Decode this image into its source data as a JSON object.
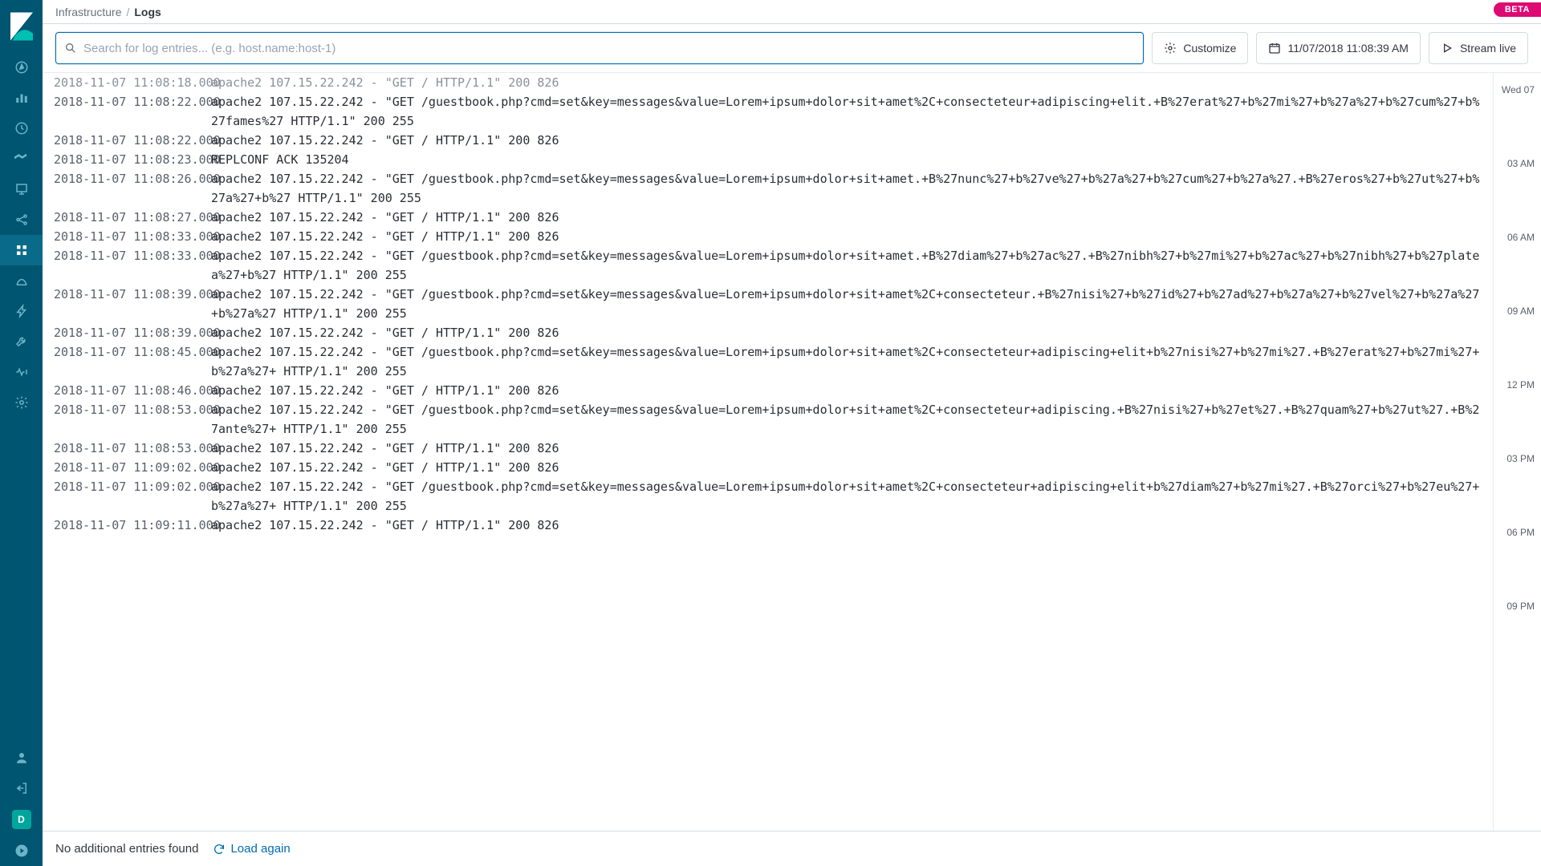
{
  "breadcrumb": {
    "parent": "Infrastructure",
    "current": "Logs"
  },
  "beta_label": "BETA",
  "search": {
    "placeholder": "Search for log entries... (e.g. host.name:host-1)"
  },
  "toolbar": {
    "customize": "Customize",
    "datetime": "11/07/2018 11:08:39 AM",
    "stream": "Stream live"
  },
  "minimap": {
    "day": "Wed 07",
    "ticks": [
      "03 AM",
      "06 AM",
      "09 AM",
      "12 PM",
      "03 PM",
      "06 PM",
      "09 PM"
    ]
  },
  "footer": {
    "status": "No additional entries found",
    "load_again": "Load again"
  },
  "user_badge": "D",
  "logs": [
    {
      "ts": "2018-11-07 11:08:18.000",
      "msg": "apache2 107.15.22.242 - \"GET / HTTP/1.1\" 200 826"
    },
    {
      "ts": "2018-11-07 11:08:22.000",
      "msg": "apache2 107.15.22.242 - \"GET /guestbook.php?cmd=set&key=messages&value=Lorem+ipsum+dolor+sit+amet%2C+consecteteur+adipiscing+elit.+B%27erat%27+b%27mi%27+b%27a%27+b%27cum%27+b%27fames%27 HTTP/1.1\" 200 255"
    },
    {
      "ts": "2018-11-07 11:08:22.000",
      "msg": "apache2 107.15.22.242 - \"GET / HTTP/1.1\" 200 826"
    },
    {
      "ts": "2018-11-07 11:08:23.000",
      "msg": "REPLCONF ACK 135204"
    },
    {
      "ts": "2018-11-07 11:08:26.000",
      "msg": "apache2 107.15.22.242 - \"GET /guestbook.php?cmd=set&key=messages&value=Lorem+ipsum+dolor+sit+amet.+B%27nunc%27+b%27ve%27+b%27a%27+b%27cum%27+b%27a%27.+B%27eros%27+b%27ut%27+b%27a%27+b%27 HTTP/1.1\" 200 255"
    },
    {
      "ts": "2018-11-07 11:08:27.000",
      "msg": "apache2 107.15.22.242 - \"GET / HTTP/1.1\" 200 826"
    },
    {
      "ts": "2018-11-07 11:08:33.000",
      "msg": "apache2 107.15.22.242 - \"GET / HTTP/1.1\" 200 826"
    },
    {
      "ts": "2018-11-07 11:08:33.000",
      "msg": "apache2 107.15.22.242 - \"GET /guestbook.php?cmd=set&key=messages&value=Lorem+ipsum+dolor+sit+amet.+B%27diam%27+b%27ac%27.+B%27nibh%27+b%27mi%27+b%27ac%27+b%27nibh%27+b%27platea%27+b%27 HTTP/1.1\" 200 255"
    },
    {
      "ts": "2018-11-07 11:08:39.000",
      "msg": "apache2 107.15.22.242 - \"GET /guestbook.php?cmd=set&key=messages&value=Lorem+ipsum+dolor+sit+amet%2C+consecteteur.+B%27nisi%27+b%27id%27+b%27ad%27+b%27a%27+b%27vel%27+b%27a%27+b%27a%27 HTTP/1.1\" 200 255"
    },
    {
      "ts": "2018-11-07 11:08:39.000",
      "msg": "apache2 107.15.22.242 - \"GET / HTTP/1.1\" 200 826"
    },
    {
      "ts": "2018-11-07 11:08:45.000",
      "msg": "apache2 107.15.22.242 - \"GET /guestbook.php?cmd=set&key=messages&value=Lorem+ipsum+dolor+sit+amet%2C+consecteteur+adipiscing+elit+b%27nisi%27+b%27mi%27.+B%27erat%27+b%27mi%27+b%27a%27+ HTTP/1.1\" 200 255"
    },
    {
      "ts": "2018-11-07 11:08:46.000",
      "msg": "apache2 107.15.22.242 - \"GET / HTTP/1.1\" 200 826"
    },
    {
      "ts": "2018-11-07 11:08:53.000",
      "msg": "apache2 107.15.22.242 - \"GET /guestbook.php?cmd=set&key=messages&value=Lorem+ipsum+dolor+sit+amet%2C+consecteteur+adipiscing.+B%27nisi%27+b%27et%27.+B%27quam%27+b%27ut%27.+B%27ante%27+ HTTP/1.1\" 200 255"
    },
    {
      "ts": "2018-11-07 11:08:53.000",
      "msg": "apache2 107.15.22.242 - \"GET / HTTP/1.1\" 200 826"
    },
    {
      "ts": "2018-11-07 11:09:02.000",
      "msg": "apache2 107.15.22.242 - \"GET / HTTP/1.1\" 200 826"
    },
    {
      "ts": "2018-11-07 11:09:02.000",
      "msg": "apache2 107.15.22.242 - \"GET /guestbook.php?cmd=set&key=messages&value=Lorem+ipsum+dolor+sit+amet%2C+consecteteur+adipiscing+elit+b%27diam%27+b%27mi%27.+B%27orci%27+b%27eu%27+b%27a%27+ HTTP/1.1\" 200 255"
    },
    {
      "ts": "2018-11-07 11:09:11.000",
      "msg": "apache2 107.15.22.242 - \"GET / HTTP/1.1\" 200 826"
    }
  ]
}
